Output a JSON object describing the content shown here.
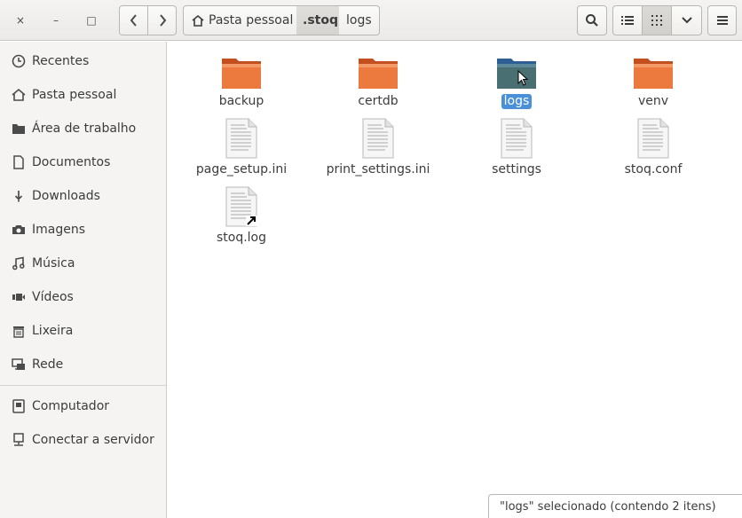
{
  "window": {
    "close_glyph": "×",
    "minimize_glyph": "–",
    "maximize_glyph": "□"
  },
  "toolbar": {
    "back_icon": "chevron-left-icon",
    "forward_icon": "chevron-right-icon",
    "search_icon": "search-icon",
    "list_view_icon": "list-icon",
    "grid_view_icon": "grid-icon",
    "view_menu_icon": "chevron-down-icon",
    "menu_icon": "hamburger-icon"
  },
  "breadcrumb": {
    "items": [
      {
        "label": "Pasta pessoal",
        "icon": "home-icon"
      },
      {
        "label": ".stoq"
      },
      {
        "label": "logs"
      }
    ]
  },
  "sidebar": {
    "items": [
      {
        "label": "Recentes",
        "icon": "clock-icon"
      },
      {
        "label": "Pasta pessoal",
        "icon": "home-icon"
      },
      {
        "label": "Área de trabalho",
        "icon": "desktop-folder-icon"
      },
      {
        "label": "Documentos",
        "icon": "document-icon"
      },
      {
        "label": "Downloads",
        "icon": "download-icon"
      },
      {
        "label": "Imagens",
        "icon": "camera-icon"
      },
      {
        "label": "Música",
        "icon": "music-icon"
      },
      {
        "label": "Vídeos",
        "icon": "video-icon"
      },
      {
        "label": "Lixeira",
        "icon": "trash-icon"
      },
      {
        "label": "Rede",
        "icon": "network-icon"
      },
      {
        "label": "Computador",
        "icon": "computer-icon"
      },
      {
        "label": "Conectar a servidor",
        "icon": "server-icon"
      }
    ]
  },
  "files": [
    {
      "name": "backup",
      "type": "folder",
      "selected": false
    },
    {
      "name": "certdb",
      "type": "folder",
      "selected": false
    },
    {
      "name": "logs",
      "type": "folder",
      "selected": true
    },
    {
      "name": "venv",
      "type": "folder",
      "selected": false
    },
    {
      "name": "page_setup.ini",
      "type": "text",
      "selected": false
    },
    {
      "name": "print_settings.ini",
      "type": "text",
      "selected": false
    },
    {
      "name": "settings",
      "type": "text",
      "selected": false
    },
    {
      "name": "stoq.conf",
      "type": "text",
      "selected": false
    },
    {
      "name": "stoq.log",
      "type": "text-link",
      "selected": false
    }
  ],
  "status": {
    "text": "\"logs\" selecionado  (contendo 2 itens)"
  },
  "colors": {
    "folder_orange": "#e96a2e",
    "folder_selected": "#3a6ea5",
    "selection": "#4a90d9"
  }
}
